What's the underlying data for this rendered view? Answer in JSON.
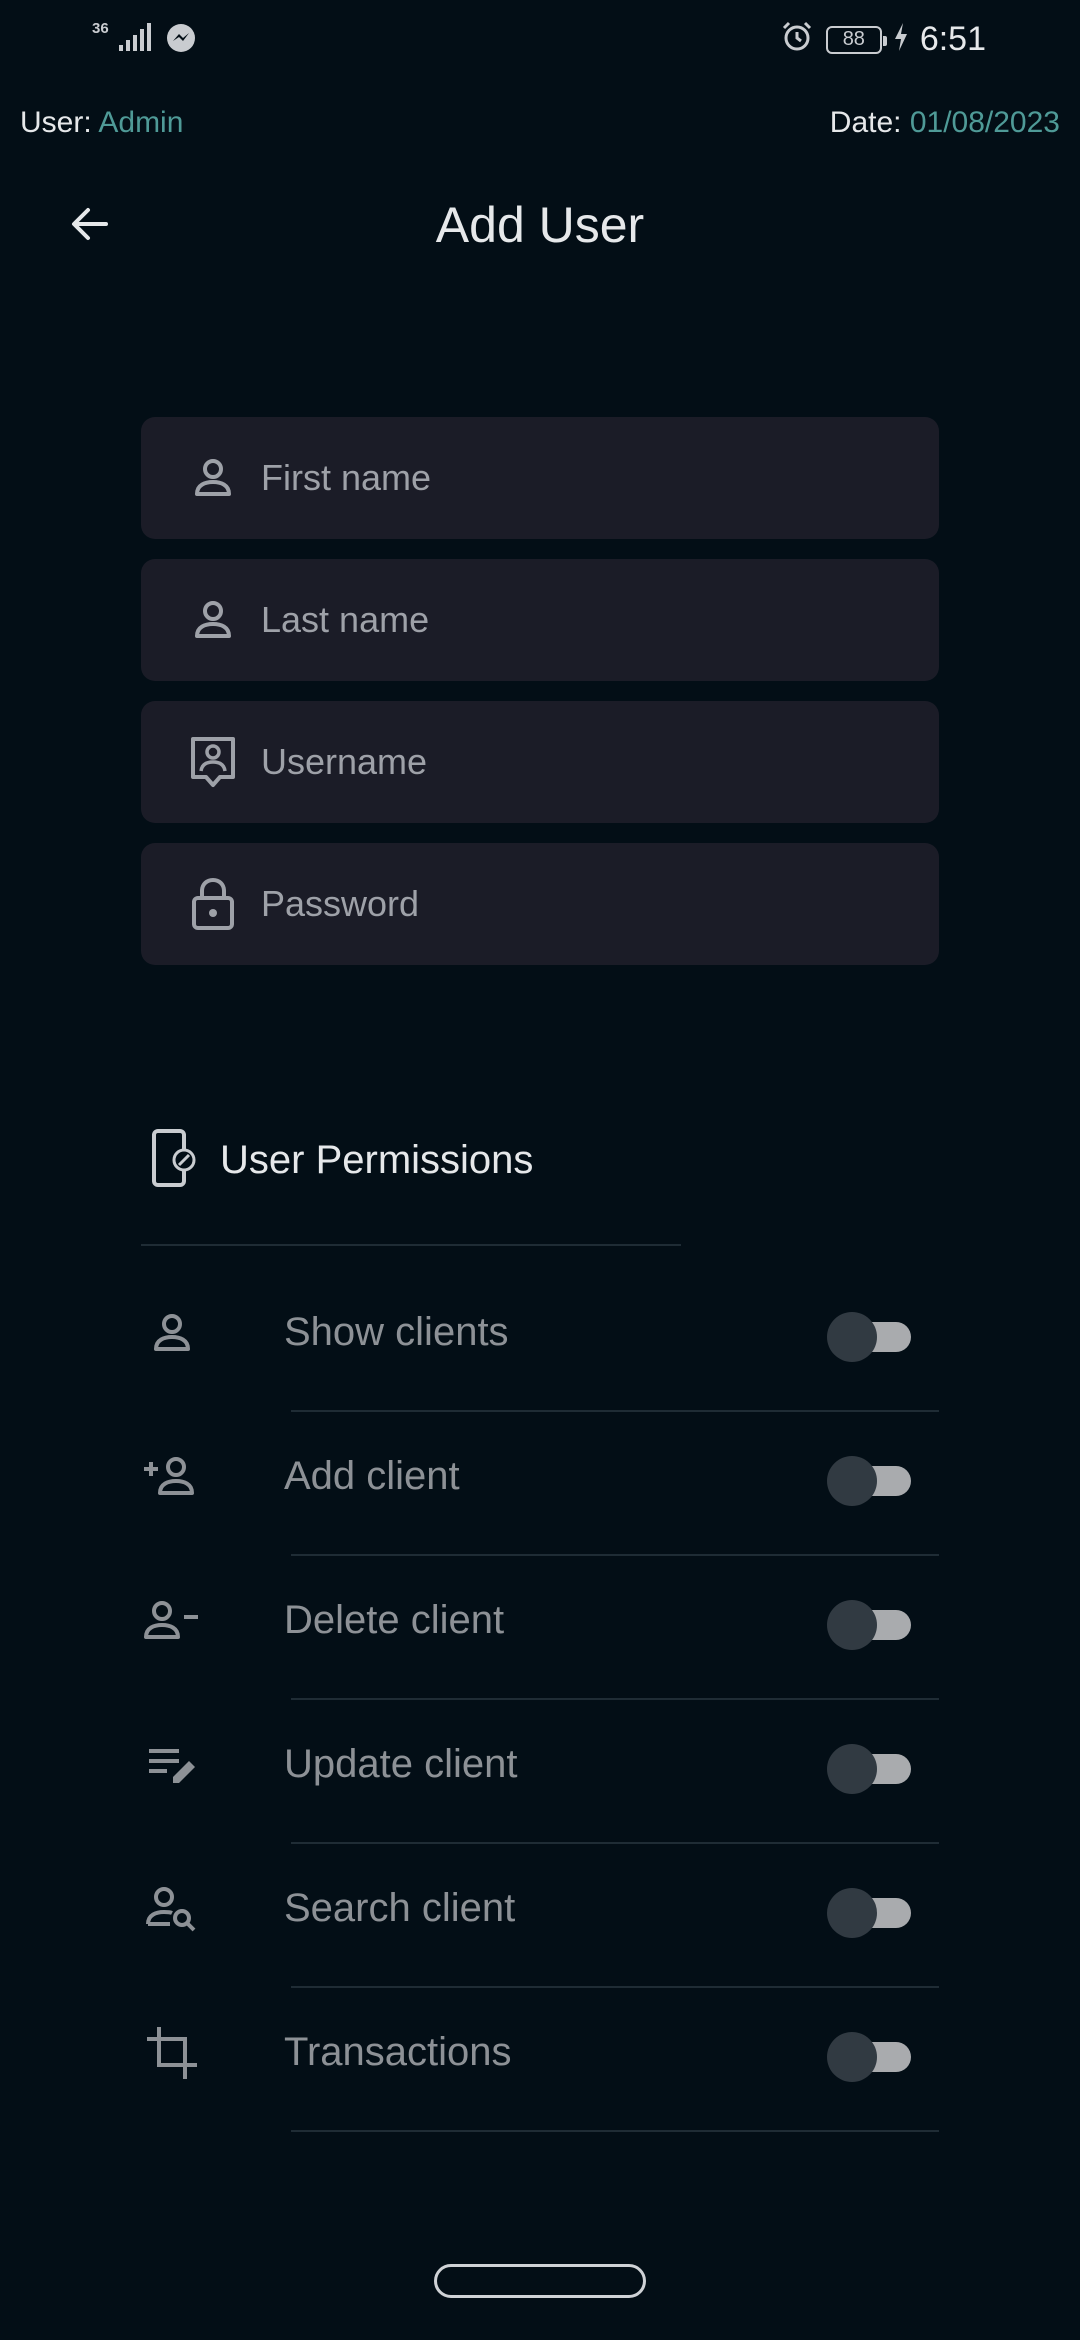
{
  "status_bar": {
    "network": "36",
    "battery": "88",
    "time": "6:51"
  },
  "info": {
    "user_label": "User:",
    "user_value": "Admin",
    "date_label": "Date:",
    "date_value": "01/08/2023"
  },
  "header": {
    "title": "Add User"
  },
  "form": {
    "first_name_placeholder": "First name",
    "last_name_placeholder": "Last name",
    "username_placeholder": "Username",
    "password_placeholder": "Password"
  },
  "permissions": {
    "title": "User Permissions",
    "items": [
      {
        "label": "Show clients",
        "icon": "person-outline-icon",
        "enabled": false
      },
      {
        "label": "Add client",
        "icon": "person-add-icon",
        "enabled": false
      },
      {
        "label": "Delete client",
        "icon": "person-remove-icon",
        "enabled": false
      },
      {
        "label": "Update client",
        "icon": "edit-note-icon",
        "enabled": false
      },
      {
        "label": "Search client",
        "icon": "person-search-icon",
        "enabled": false
      },
      {
        "label": "Transactions",
        "icon": "crop-icon",
        "enabled": false
      }
    ]
  },
  "colors": {
    "background": "#030e16",
    "field_background": "#1b1c27",
    "accent": "#4f9a97",
    "muted_text": "#8d9196"
  }
}
